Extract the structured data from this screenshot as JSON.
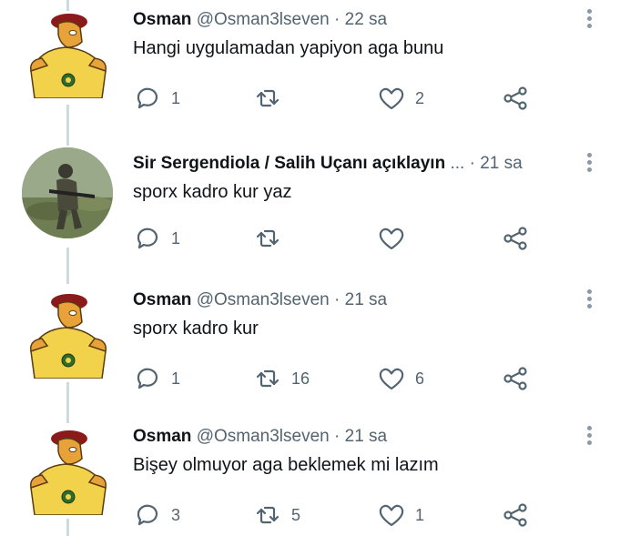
{
  "tweets": [
    {
      "name": "Osman",
      "handle": "@Osman3lseven",
      "dot": "·",
      "time": "22 sa",
      "text": "Hangi uygulamadan yapiyon aga bunu",
      "reply_count": "1",
      "retweet_count": "",
      "like_count": "2"
    },
    {
      "name": "Sir Sergendiola / Salih Uçanı açıklayın",
      "ellipsis": "...",
      "dot": "·",
      "time": "21 sa",
      "text": "sporx kadro kur yaz",
      "reply_count": "1",
      "retweet_count": "",
      "like_count": ""
    },
    {
      "name": "Osman",
      "handle": "@Osman3lseven",
      "dot": "·",
      "time": "21 sa",
      "text": "sporx kadro kur",
      "reply_count": "1",
      "retweet_count": "16",
      "like_count": "6"
    },
    {
      "name": "Osman",
      "handle": "@Osman3lseven",
      "dot": "·",
      "time": "21 sa",
      "text": "Bişey olmuyor aga beklemek mi lazım",
      "reply_count": "3",
      "retweet_count": "5",
      "like_count": "1"
    }
  ],
  "colors": {
    "text": "#0f1419",
    "secondary": "#536471",
    "thread_line": "#cfd9de"
  },
  "icons": [
    "reply-icon",
    "retweet-icon",
    "like-icon",
    "share-icon",
    "more-icon"
  ]
}
